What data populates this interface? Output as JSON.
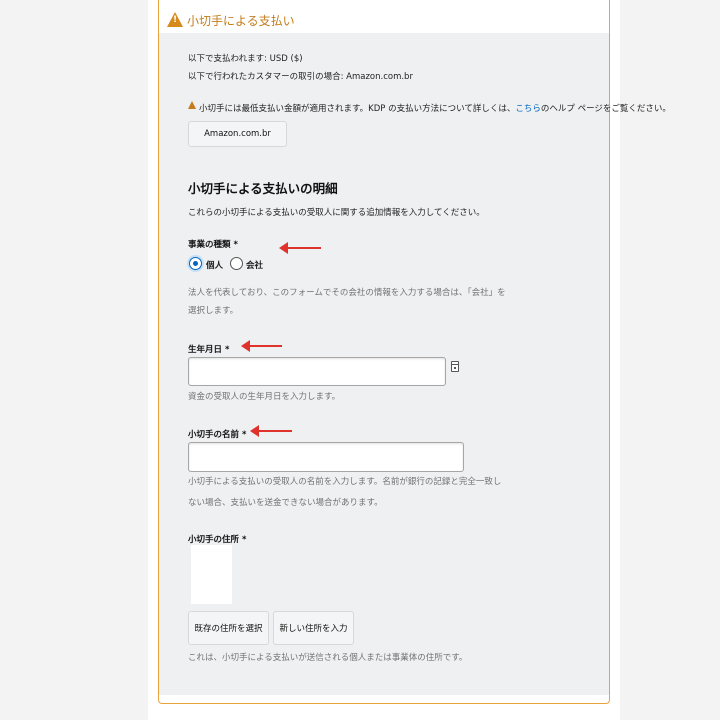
{
  "header": {
    "title": "小切手による支払い"
  },
  "payment_info": {
    "currency_line": "以下で支払われます: USD ($)",
    "marketplace_line": "以下で行われたカスタマーの取引の場合: Amazon.com.br"
  },
  "notice": {
    "text_before_link": "小切手には最低支払い金額が適用されます。KDP の支払い方法について詳しくは、",
    "link_text": "こちら",
    "text_after_link": "のヘルプ ページをご覧ください。"
  },
  "marketplace_button": "Amazon.com.br",
  "details": {
    "title": "小切手による支払いの明細",
    "description": "これらの小切手による支払いの受取人に関する追加情報を入力してください。"
  },
  "business_type": {
    "label": "事業の種類 *",
    "options": [
      {
        "label": "個人",
        "selected": true
      },
      {
        "label": "会社",
        "selected": false
      }
    ],
    "help_line1": "法人を代表しており、このフォームでその会社の情報を入力する場合は、「会社」を",
    "help_line2": "選択します。"
  },
  "birth_date": {
    "label": "生年月日 *",
    "value": "",
    "help": "資金の受取人の生年月日を入力します。"
  },
  "payee_name": {
    "label": "小切手の名前 *",
    "value": "",
    "help_line1": "小切手による支払いの受取人の名前を入力します。名前が銀行の記録と完全一致し",
    "help_line2": "ない場合、支払いを送金できない場合があります。"
  },
  "address": {
    "label": "小切手の住所 *",
    "select_existing_button": "既存の住所を選択",
    "enter_new_button": "新しい住所を入力",
    "help": "これは、小切手による支払いが送信される個人または事業体の住所です。"
  },
  "colors": {
    "accent_orange": "#c47d1a",
    "link_blue": "#0066c0",
    "annotation_red": "#e0322c",
    "panel_bg": "#eff0f2"
  }
}
